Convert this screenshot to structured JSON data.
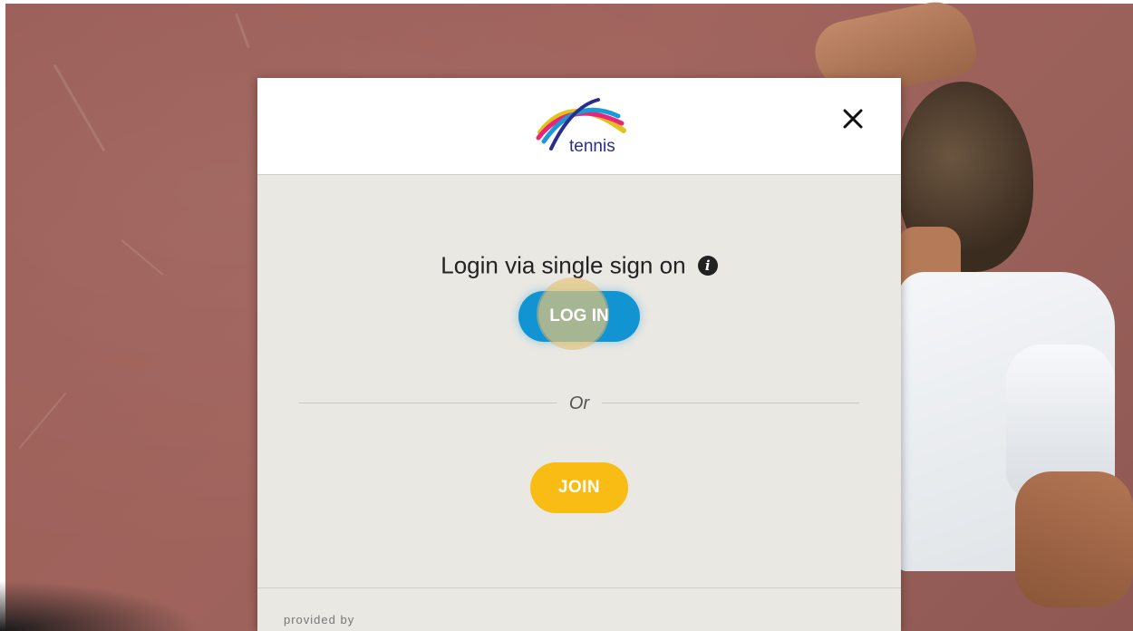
{
  "modal": {
    "logo_text": "tennis",
    "close_label": "×",
    "sso_title": "Login via single sign on",
    "info_glyph": "i",
    "login_label": "LOG IN",
    "or_label": "Or",
    "join_label": "JOIN",
    "provided_by": "provided by"
  },
  "colors": {
    "login_button": "#1294d3",
    "join_button": "#f9bc14",
    "modal_body": "#e9e8e3",
    "background": "#9b5d57"
  },
  "icons": [
    "close-icon",
    "info-icon",
    "tennis-logo"
  ]
}
